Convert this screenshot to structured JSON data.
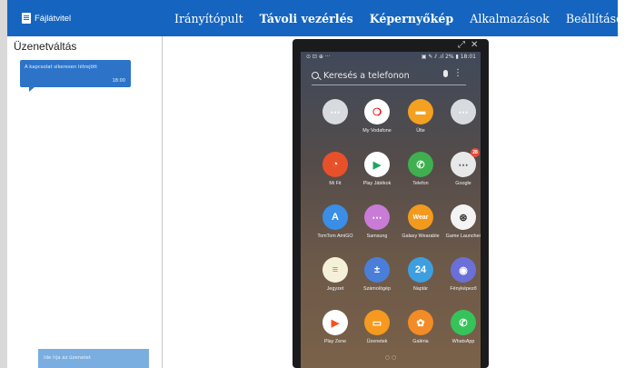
{
  "header": {
    "brand": "Fájlátvitel",
    "tabs": [
      {
        "label": "Irányítópult",
        "active": false
      },
      {
        "label": "Távoli vezérlés",
        "active": true
      },
      {
        "label": "Képernyőkép",
        "active": true
      },
      {
        "label": "Alkalmazások",
        "active": false
      },
      {
        "label": "Beállítások",
        "active": false
      }
    ]
  },
  "colors": {
    "accent": "#1565c0",
    "bubble": "#2d74c9",
    "input": "#7aaee0"
  },
  "sidebar": {
    "title": "Üzenetváltás",
    "messages": [
      {
        "text": "A kapcsolat sikeresen létrejött",
        "time": "18:00"
      }
    ],
    "input_placeholder": "Ide írja az üzenetet"
  },
  "phone": {
    "status_left": "⊙ ⊡ ⊕ ···",
    "status_right": "▣ ✎ ⫽ .ıl 2% ▮ 18:01",
    "search_placeholder": "Keresés a telefonon",
    "apps": [
      {
        "label": "",
        "icon": "folder-icon",
        "color": "#d7dbe0",
        "glyph": "⋯"
      },
      {
        "label": "My Vodafone",
        "icon": "vodafone-icon",
        "color": "#ffffff",
        "glyph": "❍",
        "fg": "#e60000"
      },
      {
        "label": "Ülte",
        "icon": "folder-app-icon",
        "color": "#f4a020",
        "glyph": "▬"
      },
      {
        "label": "",
        "icon": "folder-icon",
        "color": "#d7dbe0",
        "glyph": "⋯"
      },
      {
        "label": "Mi Fit",
        "icon": "mifit-icon",
        "color": "#e8502a",
        "glyph": "◔"
      },
      {
        "label": "Play Játékok",
        "icon": "play-games-icon",
        "color": "#ffffff",
        "glyph": "▶",
        "fg": "#1fa463"
      },
      {
        "label": "Telefon",
        "icon": "phone-icon",
        "color": "#3fb04f",
        "glyph": "✆"
      },
      {
        "label": "Google",
        "icon": "google-folder-icon",
        "color": "#e8e8e8",
        "glyph": "⋯",
        "fg": "#555",
        "badge": "28"
      },
      {
        "label": "TomTom AmiGO",
        "icon": "tomtom-icon",
        "color": "#3a8ee6",
        "glyph": "A"
      },
      {
        "label": "Samsung",
        "icon": "samsung-folder-icon",
        "color": "#c97bd6",
        "glyph": "⋯"
      },
      {
        "label": "Galaxy Wearable",
        "icon": "wear-icon",
        "color": "#f29a1e",
        "glyph": "Wear"
      },
      {
        "label": "Game Launcher",
        "icon": "game-launcher-icon",
        "color": "#f4f4f4",
        "glyph": "⊛",
        "fg": "#333"
      },
      {
        "label": "Jegyzet",
        "icon": "notes-icon",
        "color": "#f5f0d8",
        "glyph": "≡",
        "fg": "#b58b3a"
      },
      {
        "label": "Számológép",
        "icon": "calculator-icon",
        "color": "#4a7fd9",
        "glyph": "±"
      },
      {
        "label": "Naptár",
        "icon": "calendar-icon",
        "color": "#3d9fe0",
        "glyph": "24"
      },
      {
        "label": "Fényképező",
        "icon": "camera-icon",
        "color": "#6b6fd8",
        "glyph": "◉"
      },
      {
        "label": "Play Zene",
        "icon": "play-music-icon",
        "color": "#ffffff",
        "glyph": "▶",
        "fg": "#f4511e"
      },
      {
        "label": "Üzenetek",
        "icon": "messages-icon",
        "color": "#f59a1f",
        "glyph": "▭"
      },
      {
        "label": "Galéria",
        "icon": "gallery-icon",
        "color": "#f38b27",
        "glyph": "✿"
      },
      {
        "label": "WhatsApp",
        "icon": "whatsapp-icon",
        "color": "#36c35a",
        "glyph": "✆"
      }
    ],
    "page_dots": "○ ○"
  }
}
